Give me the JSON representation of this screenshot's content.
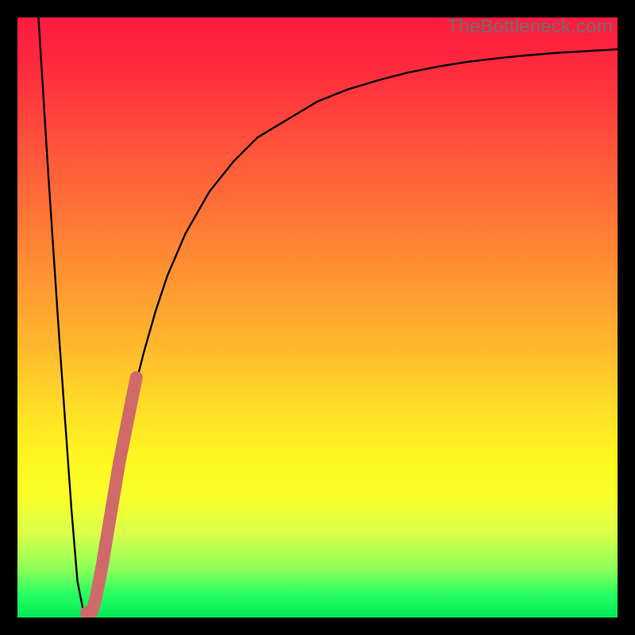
{
  "watermark": {
    "text": "TheBottleneck.com"
  },
  "chart_data": {
    "type": "line",
    "title": "",
    "xlabel": "",
    "ylabel": "",
    "xlim": [
      0,
      100
    ],
    "ylim": [
      0,
      100
    ],
    "grid": false,
    "series": [
      {
        "name": "bottleneck-curve",
        "x": [
          3.5,
          4,
          5,
          6,
          7,
          8,
          9,
          10,
          11,
          12,
          13,
          14,
          15,
          17,
          19,
          21,
          23,
          25,
          28,
          32,
          36,
          40,
          45,
          50,
          55,
          60,
          65,
          70,
          75,
          80,
          85,
          90,
          95,
          100
        ],
        "values": [
          100,
          92,
          76,
          61,
          46,
          32,
          18,
          6,
          1,
          0,
          2,
          7,
          14,
          26,
          36,
          44,
          51,
          57,
          64,
          71,
          76,
          80,
          83,
          86,
          88,
          89.5,
          90.8,
          91.8,
          92.6,
          93.2,
          93.7,
          94.1,
          94.4,
          94.7
        ],
        "color": "#000000",
        "linewidth": 2
      },
      {
        "name": "highlight-segment",
        "x": [
          11.5,
          12,
          12.4,
          13,
          13.4,
          14,
          15,
          16,
          17,
          18,
          19,
          19.8
        ],
        "values": [
          0.8,
          0.3,
          1,
          3,
          5,
          8,
          14,
          20,
          26,
          31,
          36,
          40
        ],
        "color": "#d06a6a",
        "linewidth": 10
      }
    ],
    "background": {
      "type": "vertical-gradient",
      "stops": [
        {
          "pos": 0,
          "color": "#ff1a3e"
        },
        {
          "pos": 40,
          "color": "#ff8a34"
        },
        {
          "pos": 70,
          "color": "#fff022"
        },
        {
          "pos": 100,
          "color": "#00ea57"
        }
      ]
    }
  }
}
